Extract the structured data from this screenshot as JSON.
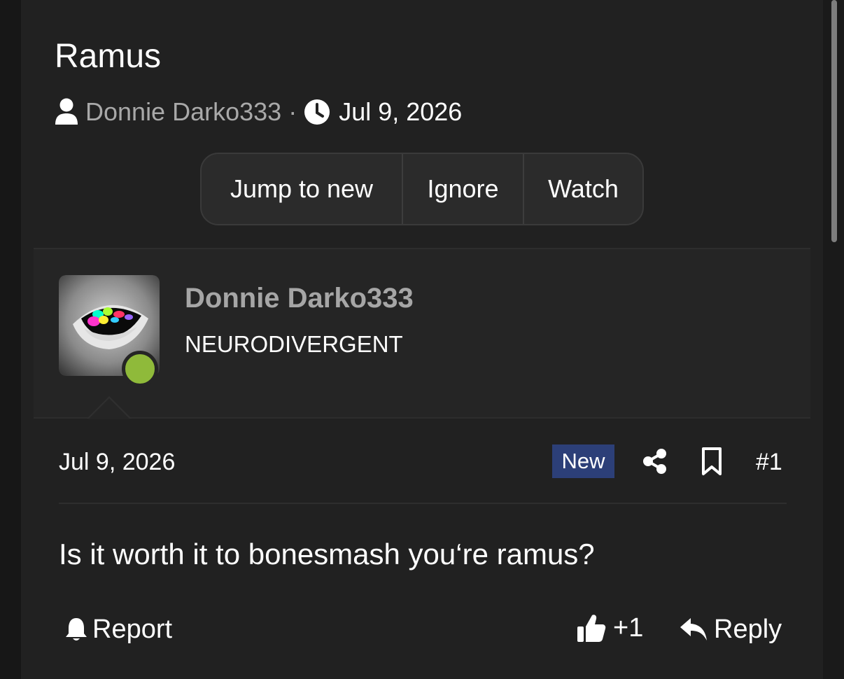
{
  "thread": {
    "title": "Ramus",
    "author": "Donnie Darko333",
    "separator": "·",
    "date": "Jul 9, 2026"
  },
  "thread_actions": [
    {
      "label": "Jump to new"
    },
    {
      "label": "Ignore"
    },
    {
      "label": "Watch"
    }
  ],
  "post": {
    "username": "Donnie Darko333",
    "user_title": "NEURODIVERGENT",
    "online_status_color": "#8fba3a",
    "date": "Jul 9, 2026",
    "badge": "New",
    "badge_color": "#2c3f78",
    "number": "#1",
    "body": "Is it worth it to bonesmash you‘re ramus?",
    "report_label": "Report",
    "like_count": "+1",
    "reply_label": "Reply"
  },
  "icons": {
    "author": "user-icon",
    "date": "clock-icon",
    "share": "share-icon",
    "bookmark": "bookmark-icon",
    "report": "bell-icon",
    "like": "thumbs-up-icon",
    "reply": "reply-arrow-icon"
  }
}
